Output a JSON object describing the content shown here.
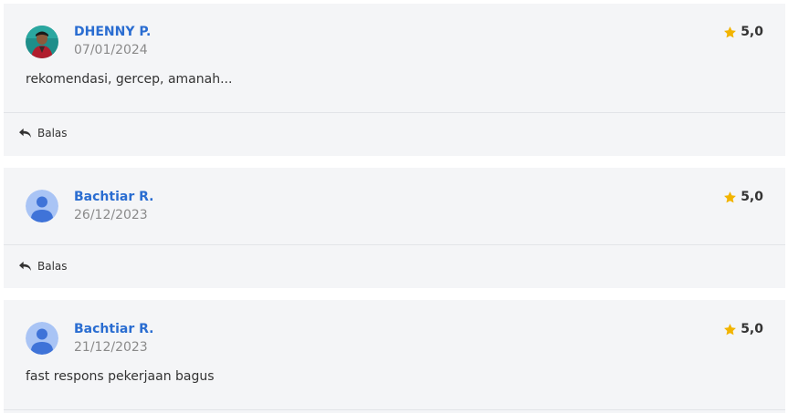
{
  "reviews": [
    {
      "name": "DHENNY P.",
      "date": "07/01/2024",
      "rating": "5,0",
      "comment": "rekomendasi, gercep, amanah...",
      "avatar": "photo-avatar",
      "reply_label": "Balas"
    },
    {
      "name": "Bachtiar R.",
      "date": "26/12/2023",
      "rating": "5,0",
      "comment": "",
      "avatar": "default-user-avatar",
      "reply_label": "Balas"
    },
    {
      "name": "Bachtiar R.",
      "date": "21/12/2023",
      "rating": "5,0",
      "comment": "fast respons pekerjaan bagus",
      "avatar": "default-user-avatar"
    }
  ],
  "colors": {
    "name": "#2a6dd1",
    "star": "#f2b400",
    "card_bg": "#f4f5f7",
    "avatar_bg": "#a9c4f5",
    "avatar_fg": "#3f73d8"
  },
  "icons": {
    "rating": "star-icon",
    "reply": "reply-arrow-icon"
  }
}
